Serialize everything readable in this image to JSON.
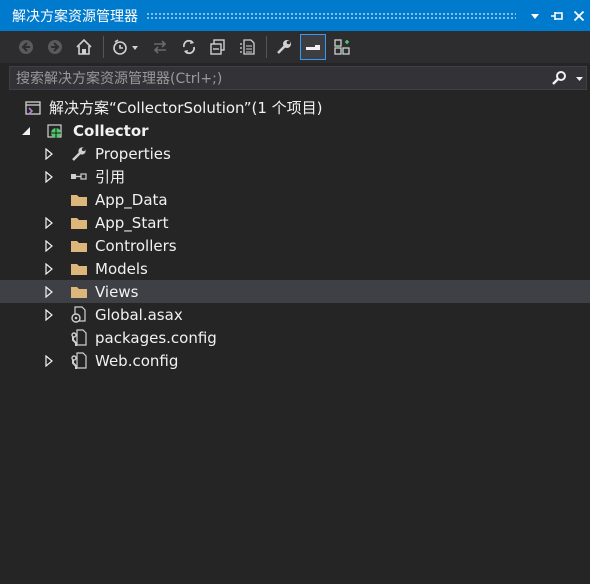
{
  "window": {
    "title": "解决方案资源管理器",
    "pin_glyph": "⊣",
    "close_glyph": "✕",
    "dropdown_glyph": "▾"
  },
  "toolbar": {
    "buttons": [
      {
        "name": "back-button",
        "icon": "back-arrow-icon"
      },
      {
        "name": "forward-button",
        "icon": "forward-arrow-icon"
      },
      {
        "name": "home-button",
        "icon": "home-icon"
      },
      {
        "name": "pending-changes-button",
        "icon": "clock-icon"
      },
      {
        "name": "sync-button",
        "icon": "sync-arrows-icon"
      },
      {
        "name": "refresh-button",
        "icon": "refresh-icon"
      },
      {
        "name": "collapse-all-button",
        "icon": "collapse-icon"
      },
      {
        "name": "show-all-files-button",
        "icon": "show-files-icon"
      },
      {
        "name": "properties-button",
        "icon": "wrench-icon"
      },
      {
        "name": "preview-button",
        "icon": "preview-icon",
        "active": true
      },
      {
        "name": "class-view-button",
        "icon": "class-diagram-icon"
      }
    ]
  },
  "search": {
    "placeholder": "搜索解决方案资源管理器(Ctrl+;)"
  },
  "tree": {
    "solution": {
      "label": "解决方案“CollectorSolution”(1 个项目)"
    },
    "project": {
      "label": "Collector"
    },
    "items": [
      {
        "label": "Properties",
        "icon": "wrench-icon",
        "expandable": true
      },
      {
        "label": "引用",
        "icon": "references-icon",
        "expandable": true
      },
      {
        "label": "App_Data",
        "icon": "folder-icon",
        "expandable": false
      },
      {
        "label": "App_Start",
        "icon": "folder-icon",
        "expandable": true
      },
      {
        "label": "Controllers",
        "icon": "folder-icon",
        "expandable": true
      },
      {
        "label": "Models",
        "icon": "folder-icon",
        "expandable": true
      },
      {
        "label": "Views",
        "icon": "folder-icon",
        "expandable": true,
        "selected": true
      },
      {
        "label": "Global.asax",
        "icon": "global-asax-icon",
        "expandable": true
      },
      {
        "label": "packages.config",
        "icon": "config-icon",
        "expandable": false
      },
      {
        "label": "Web.config",
        "icon": "config-icon",
        "expandable": true
      }
    ]
  },
  "colors": {
    "accent": "#007acc",
    "background": "#252526",
    "folder": "#dcb67a",
    "selected_row": "#3f3f46"
  }
}
